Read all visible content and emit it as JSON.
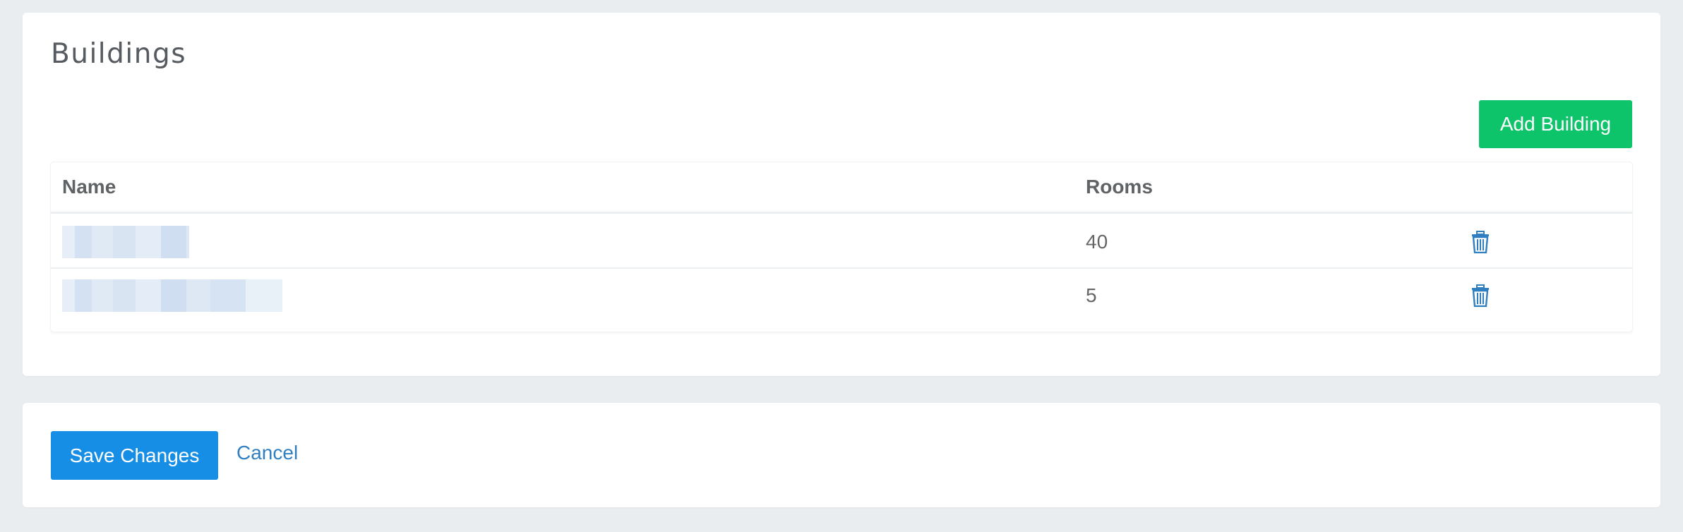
{
  "buildings_panel": {
    "title": "Buildings",
    "add_button_label": "Add Building",
    "table": {
      "columns": [
        "Name",
        "Rooms",
        ""
      ],
      "rows": [
        {
          "name": "",
          "rooms": "40",
          "action_icon": "trash-icon"
        },
        {
          "name": "",
          "rooms": "5",
          "action_icon": "trash-icon"
        }
      ]
    }
  },
  "actions_panel": {
    "save_label": "Save Changes",
    "cancel_label": "Cancel"
  },
  "colors": {
    "background": "#e9edf0",
    "add_button": "#0ec46a",
    "save_button": "#168ee6",
    "link": "#2f7fc1",
    "trash_icon": "#2f7fc1"
  }
}
